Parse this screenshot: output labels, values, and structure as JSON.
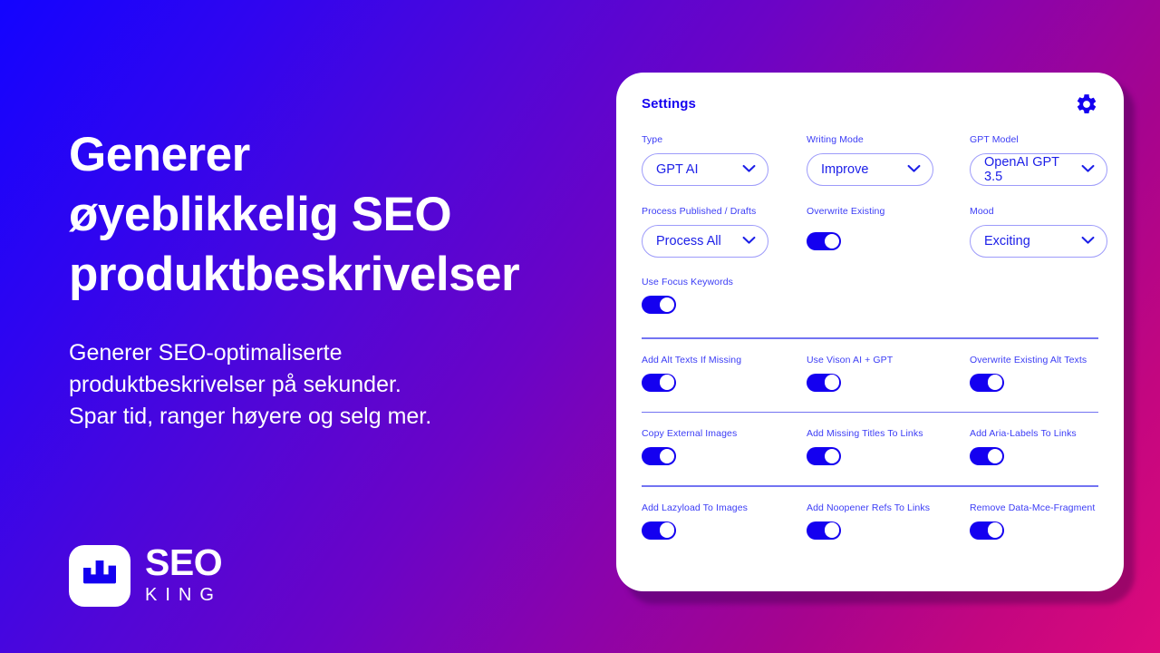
{
  "background": {
    "gradient_from": "#1304ff",
    "gradient_mid": "#8a03ac",
    "gradient_to": "#dd0a7b"
  },
  "hero": {
    "title": "Generer\nøyeblikkelig SEO\nproduktbeskrivelser",
    "subtitle": "Generer SEO-optimaliserte\nproduktbeskrivelser på sekunder.\nSpar tid, ranger høyere og selg mer."
  },
  "logo": {
    "mark_icon": "seo-king-crown-icon",
    "primary": "SEO",
    "secondary": "KING",
    "mark_color": "#1400f0"
  },
  "card": {
    "title": "Settings",
    "gear_icon": "gear-icon",
    "accent": "#1400f0",
    "label_color": "#3b3cf5",
    "row1": {
      "type": {
        "label": "Type",
        "value": "GPT AI",
        "caret_icon": "chevron-down-icon"
      },
      "writing_mode": {
        "label": "Writing Mode",
        "value": "Improve",
        "caret_icon": "chevron-down-icon"
      },
      "gpt_model": {
        "label": "GPT Model",
        "value": "OpenAI GPT 3.5",
        "caret_icon": "chevron-down-icon"
      }
    },
    "row2": {
      "process": {
        "label": "Process Published / Drafts",
        "value": "Process All",
        "caret_icon": "chevron-down-icon"
      },
      "overwrite_existing": {
        "label": "Overwrite Existing",
        "state": "on"
      },
      "mood": {
        "label": "Mood",
        "value": "Exciting",
        "caret_icon": "chevron-down-icon"
      }
    },
    "row3": {
      "focus_keywords": {
        "label": "Use Focus Keywords",
        "state": "on"
      }
    },
    "section_alt": [
      {
        "label": "Add Alt Texts If Missing",
        "state": "on"
      },
      {
        "label": "Use Vison AI + GPT",
        "state": "on"
      },
      {
        "label": "Overwrite Existing Alt Texts",
        "state": "on"
      }
    ],
    "section_images": [
      {
        "label": "Copy External Images",
        "state": "on"
      },
      {
        "label": "Add Missing Titles To Links",
        "state": "on"
      },
      {
        "label": "Add Aria-Labels To Links",
        "state": "on"
      }
    ],
    "section_misc": [
      {
        "label": "Add Lazyload To Images",
        "state": "on"
      },
      {
        "label": "Add Noopener Refs To Links",
        "state": "on"
      },
      {
        "label": "Remove Data-Mce-Fragment",
        "state": "on"
      }
    ]
  }
}
